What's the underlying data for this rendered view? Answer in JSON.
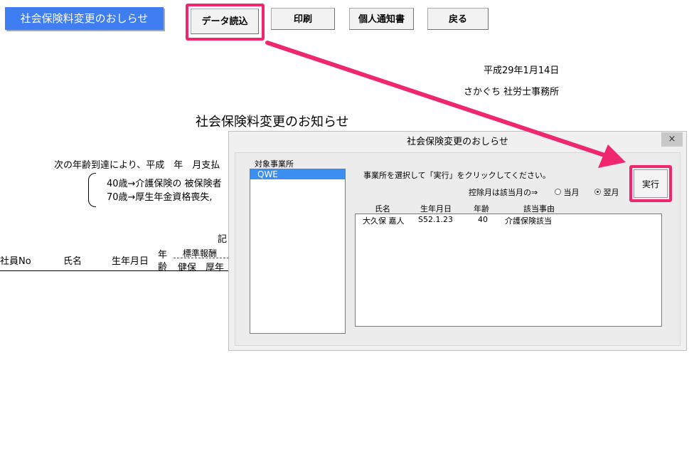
{
  "toolbar": {
    "title_button": "社会保険料変更のおしらせ",
    "data_read": "データ読込",
    "print": "印刷",
    "personal_notice": "個人通知書",
    "back": "戻る"
  },
  "sheet": {
    "date": "平成29年1月14日",
    "office": "さかぐち 社労士事務所",
    "doc_title": "社会保険料変更のお知らせ",
    "intro": "次の年齢到達により、平成　年　月支払",
    "line_40": "40歳→介護保険の 被保険者",
    "line_70": "70歳→厚生年金資格喪失,",
    "record_mark": "記",
    "col_employee_no": "社員No",
    "col_name": "氏名",
    "col_birth": "生年月日",
    "col_age_top": "年",
    "col_age_bottom": "齢",
    "col_std_pay": "標準報酬",
    "col_health": "健保",
    "col_pension": "厚年"
  },
  "dialog": {
    "title": "社会保険変更のおしらせ",
    "close": "×",
    "office_label": "対象事業所",
    "offices": [
      "QWE"
    ],
    "instruction": "事業所を選択して「実行」をクリックしてください。",
    "deduct_label": "控除月は該当月の⇒",
    "radio_current": "当月",
    "radio_next": "翌月",
    "selected_radio": "翌月",
    "execute": "実行",
    "list_headers": {
      "name": "氏名",
      "birth": "生年月日",
      "age": "年齢",
      "reason": "該当事由"
    },
    "rows": [
      {
        "name": "大久保 嘉人",
        "birth": "S52.1.23",
        "age": "40",
        "reason": "介護保険該当"
      }
    ]
  },
  "colors": {
    "accent": "#3f7df3",
    "highlight": "#f0266f",
    "selection": "#3c8ef0"
  }
}
